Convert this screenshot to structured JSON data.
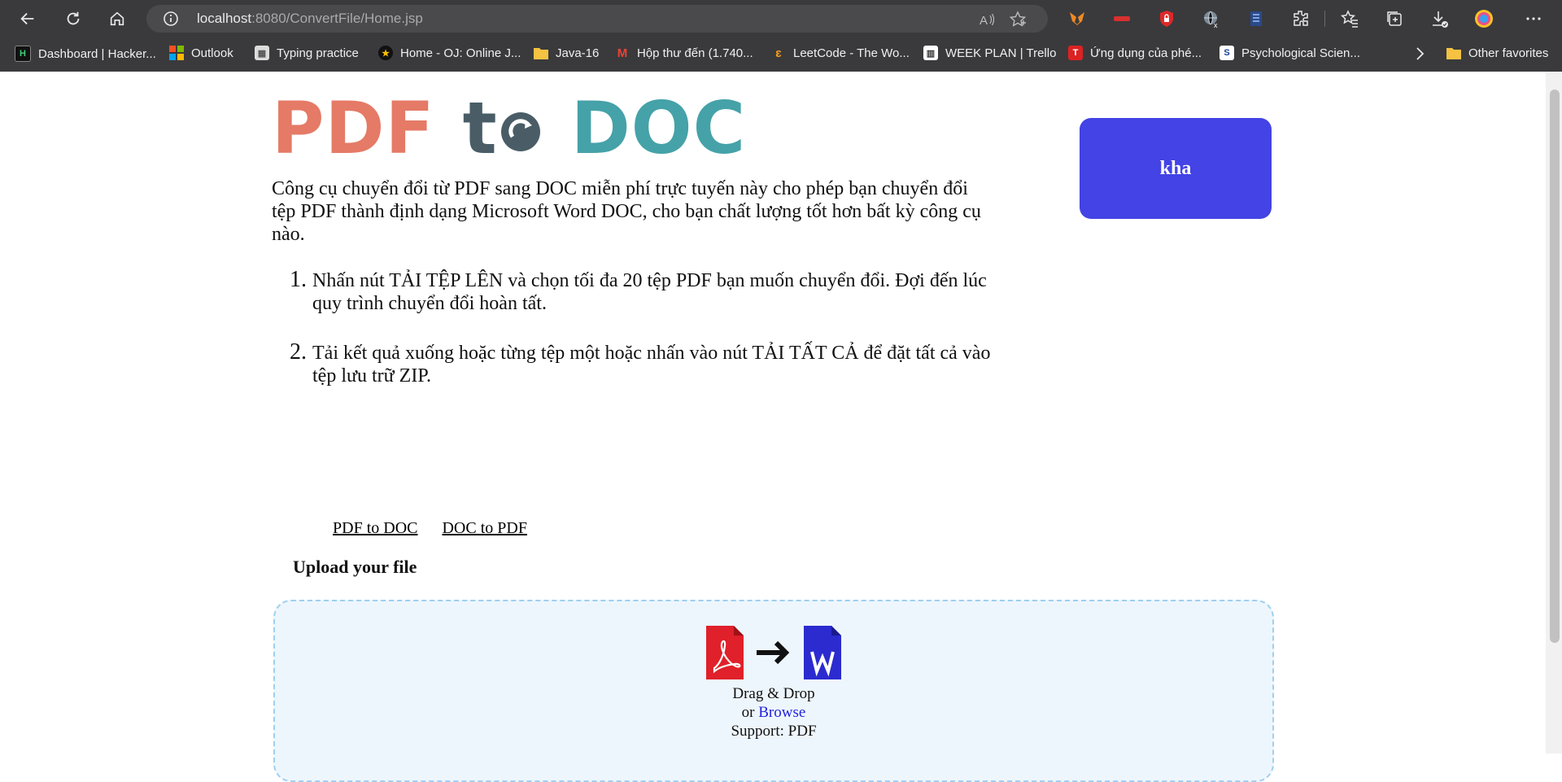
{
  "browser": {
    "url_host": "localhost",
    "url_rest": ":8080/ConvertFile/Home.jsp"
  },
  "bookmarks": [
    {
      "label": "Dashboard | Hacker...",
      "icon": "hackerrank-icon"
    },
    {
      "label": "Outlook",
      "icon": "outlook-icon"
    },
    {
      "label": "Typing practice",
      "icon": "typing-icon"
    },
    {
      "label": "Home - OJ: Online J...",
      "icon": "oj-icon"
    },
    {
      "label": "Java-16",
      "icon": "folder-icon"
    },
    {
      "label": "Hộp thư đến (1.740...",
      "icon": "gmail-icon"
    },
    {
      "label": "LeetCode - The Wo...",
      "icon": "leetcode-icon"
    },
    {
      "label": "WEEK PLAN | Trello",
      "icon": "trello-icon"
    },
    {
      "label": "Ứng dụng của phé...",
      "icon": "app-icon"
    },
    {
      "label": "Psychological Scien...",
      "icon": "science-icon"
    }
  ],
  "other_favorites": "Other favorites",
  "logo": {
    "pdf": "PDF",
    "to": "t",
    "doc": "DOC"
  },
  "user": {
    "name": "kha"
  },
  "intro": "Công cụ chuyển đổi từ PDF sang DOC miễn phí trực tuyến này cho phép bạn chuyển đổi tệp PDF thành định dạng Microsoft Word DOC, cho bạn chất lượng tốt hơn bất kỳ công cụ nào.",
  "steps": [
    "Nhấn nút TẢI TỆP LÊN và chọn tối đa 20 tệp PDF bạn muốn chuyển đổi. Đợi đến lúc quy trình chuyển đổi hoàn tất.",
    "Tải kết quả xuống hoặc từng tệp một hoặc nhấn vào nút TẢI TẤT CẢ để đặt tất cả vào tệp lưu trữ ZIP."
  ],
  "nav": {
    "pdf_to_doc": "PDF to DOC",
    "doc_to_pdf": "DOC to PDF"
  },
  "upload": {
    "title": "Upload your file",
    "drag_drop": "Drag & Drop",
    "or": "or",
    "browse": "Browse",
    "support": "Support: PDF"
  },
  "colors": {
    "user_button": "#4343e6",
    "logo_pdf": "#e57a66",
    "logo_to": "#4a5d67",
    "logo_doc": "#45a2a8",
    "pdf_icon": "#e0202a",
    "word_icon": "#2b2bd0"
  }
}
